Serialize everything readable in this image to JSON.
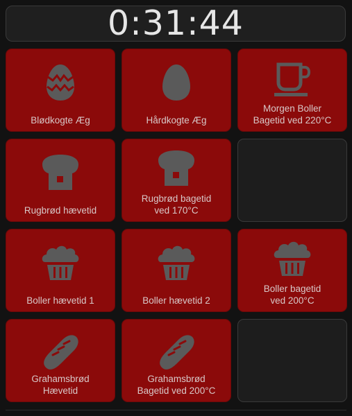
{
  "timer": {
    "display": "0:31:44"
  },
  "colors": {
    "tile_active": "#8b0a0a",
    "tile_empty": "#1d1d1d",
    "icon": "#5a5a5a",
    "label": "#d8c8c8"
  },
  "tiles": [
    {
      "label": "Blødkogte Æg",
      "icon": "egg-decorated-icon"
    },
    {
      "label": "Hårdkogte Æg",
      "icon": "egg-icon"
    },
    {
      "label": "Morgen Boller\nBagetid ved 220°C",
      "icon": "coffee-cup-icon"
    },
    {
      "label": "Rugbrød hævetid",
      "icon": "bread-loaf-icon"
    },
    {
      "label": "Rugbrød bagetid\nved 170°C",
      "icon": "bread-loaf-icon"
    },
    {
      "label": "Boller hævetid 1",
      "icon": "muffin-icon"
    },
    {
      "label": "Boller hævetid 2",
      "icon": "muffin-icon"
    },
    {
      "label": "Boller bagetid\nved 200°C",
      "icon": "muffin-icon"
    },
    {
      "label": "Grahamsbrød\nHævetid",
      "icon": "baguette-icon"
    },
    {
      "label": "Grahamsbrød\nBagetid ved 200°C",
      "icon": "baguette-icon"
    }
  ]
}
